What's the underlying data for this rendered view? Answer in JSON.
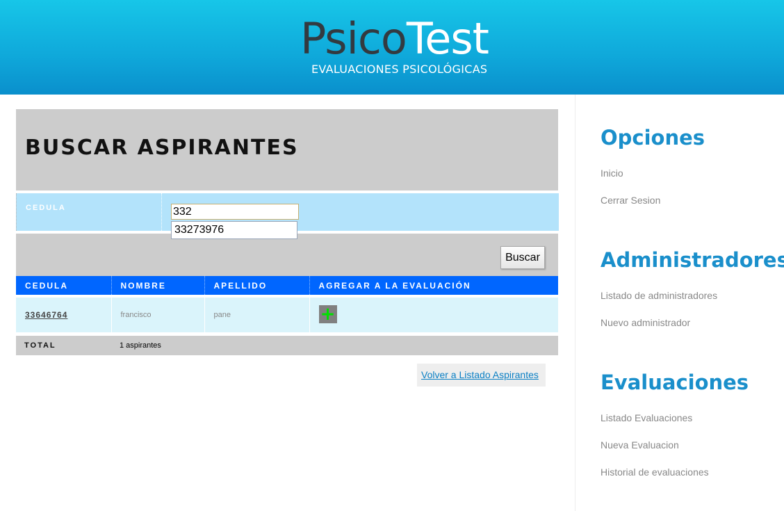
{
  "header": {
    "logo_part1": "Psico",
    "logo_part2": "Test",
    "logo_subtitle": "EVALUACIONES PSICOLÓGICAS"
  },
  "main": {
    "title": "BUSCAR ASPIRANTES",
    "form": {
      "label": "CEDULA",
      "value": "332",
      "suggestion": "33273976"
    },
    "search_button": "Buscar",
    "table": {
      "columns": [
        "CEDULA",
        "NOMBRE",
        "APELLIDO",
        "AGREGAR A LA EVALUACIÓN"
      ],
      "rows": [
        {
          "cedula": "33646764",
          "nombre": "francisco",
          "apellido": "pane",
          "add_icon": "plus-icon"
        }
      ]
    },
    "total": {
      "label": "TOTAL",
      "value": "1 aspirantes"
    },
    "back_link": "Volver a Listado Aspirantes"
  },
  "sidebar": {
    "sections": [
      {
        "title": "Opciones",
        "links": [
          "Inicio",
          "Cerrar Sesion"
        ]
      },
      {
        "title": "Administradores",
        "links": [
          "Listado de administradores",
          "Nuevo administrador"
        ]
      },
      {
        "title": "Evaluaciones",
        "links": [
          "Listado Evaluaciones",
          "Nueva Evaluacion",
          "Historial de evaluaciones"
        ]
      }
    ]
  },
  "colors": {
    "header_gradient_top": "#17c6e8",
    "header_gradient_bottom": "#0a8fcc",
    "sidebar_title": "#1a8fcb",
    "table_header": "#0066ff",
    "form_row": "#b3e3fb",
    "table_row": "#daf4fb",
    "add_icon": "#00e000"
  }
}
